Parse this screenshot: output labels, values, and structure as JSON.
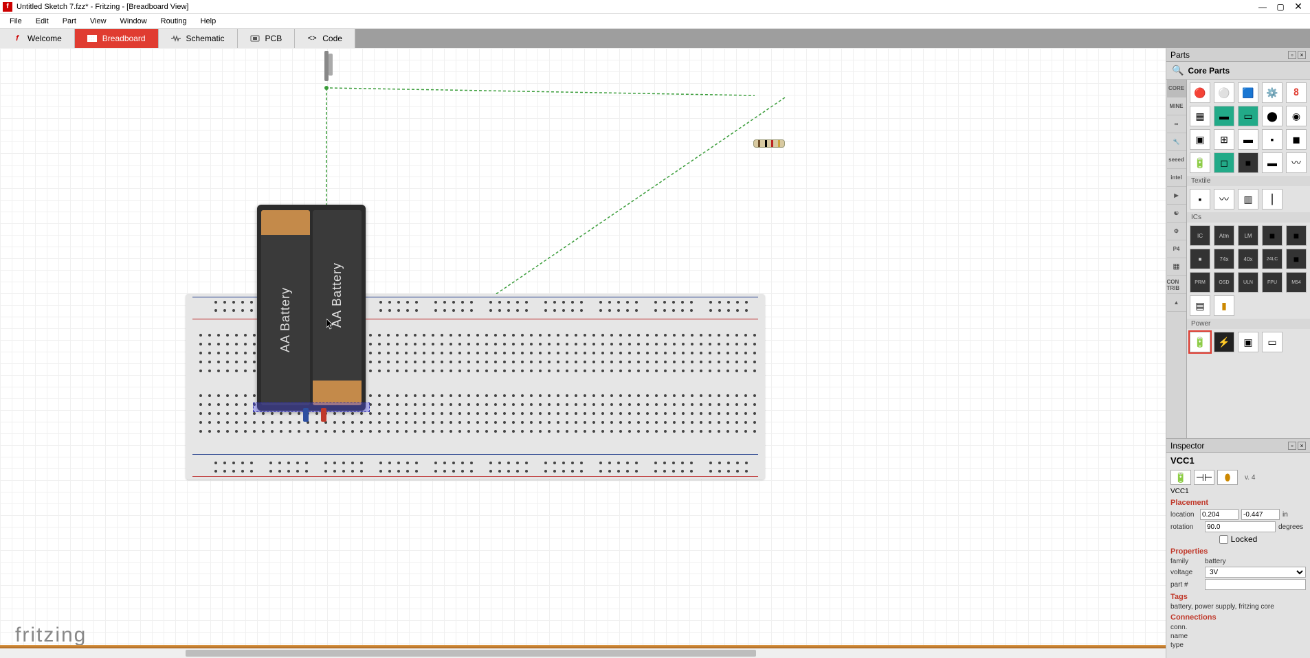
{
  "window": {
    "title": "Untitled Sketch 7.fzz* - Fritzing - [Breadboard View]",
    "app_letter": "f"
  },
  "menu": [
    "File",
    "Edit",
    "Part",
    "View",
    "Window",
    "Routing",
    "Help"
  ],
  "tabs": {
    "welcome": "Welcome",
    "breadboard": "Breadboard",
    "schematic": "Schematic",
    "pcb": "PCB",
    "code": "Code"
  },
  "logo": "fritzing",
  "battery_label": "AA Battery",
  "parts_panel": {
    "title": "Parts",
    "core_title": "Core Parts",
    "bins": [
      "CORE",
      "MINE",
      "∞",
      "🔧",
      "seeed",
      "intel",
      "▶",
      "☯",
      "⚙",
      "P4",
      "🎛",
      "CON TRIB",
      "▲"
    ],
    "sections": {
      "textile": "Textile",
      "ics": "ICs",
      "power": "Power"
    }
  },
  "inspector": {
    "title": "Inspector",
    "part_name": "VCC1",
    "version": "v. 4",
    "part_sub": "VCC1",
    "placement_label": "Placement",
    "location_label": "location",
    "loc_x": "0.204",
    "loc_y": "-0.447",
    "loc_unit": "in",
    "rotation_label": "rotation",
    "rotation_val": "90.0",
    "rotation_unit": "degrees",
    "locked_label": "Locked",
    "properties_label": "Properties",
    "family_label": "family",
    "family_val": "battery",
    "voltage_label": "voltage",
    "voltage_val": "3V",
    "partnum_label": "part #",
    "partnum_val": "",
    "tags_label": "Tags",
    "tags_val": "battery, power supply, fritzing core",
    "connections_label": "Connections",
    "conn_label": "conn.",
    "name_label": "name",
    "type_label": "type"
  }
}
